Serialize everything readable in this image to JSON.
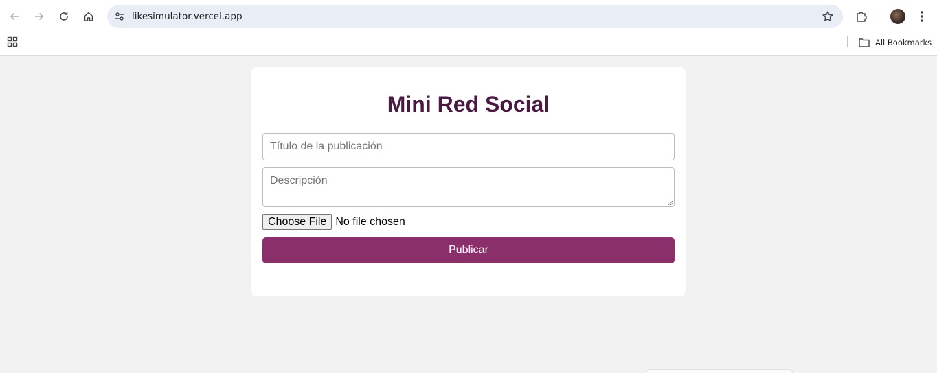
{
  "browser": {
    "url": "likesimulator.vercel.app",
    "bookmarks_label": "All Bookmarks"
  },
  "app": {
    "title": "Mini Red Social",
    "title_placeholder": "Título de la publicación",
    "description_placeholder": "Descripción",
    "file_button_label": "Choose File",
    "file_status": "No file chosen",
    "publish_label": "Publicar",
    "colors": {
      "title": "#4a1942",
      "publish_button": "#8b2f6b",
      "background": "#f2f2f2"
    }
  }
}
